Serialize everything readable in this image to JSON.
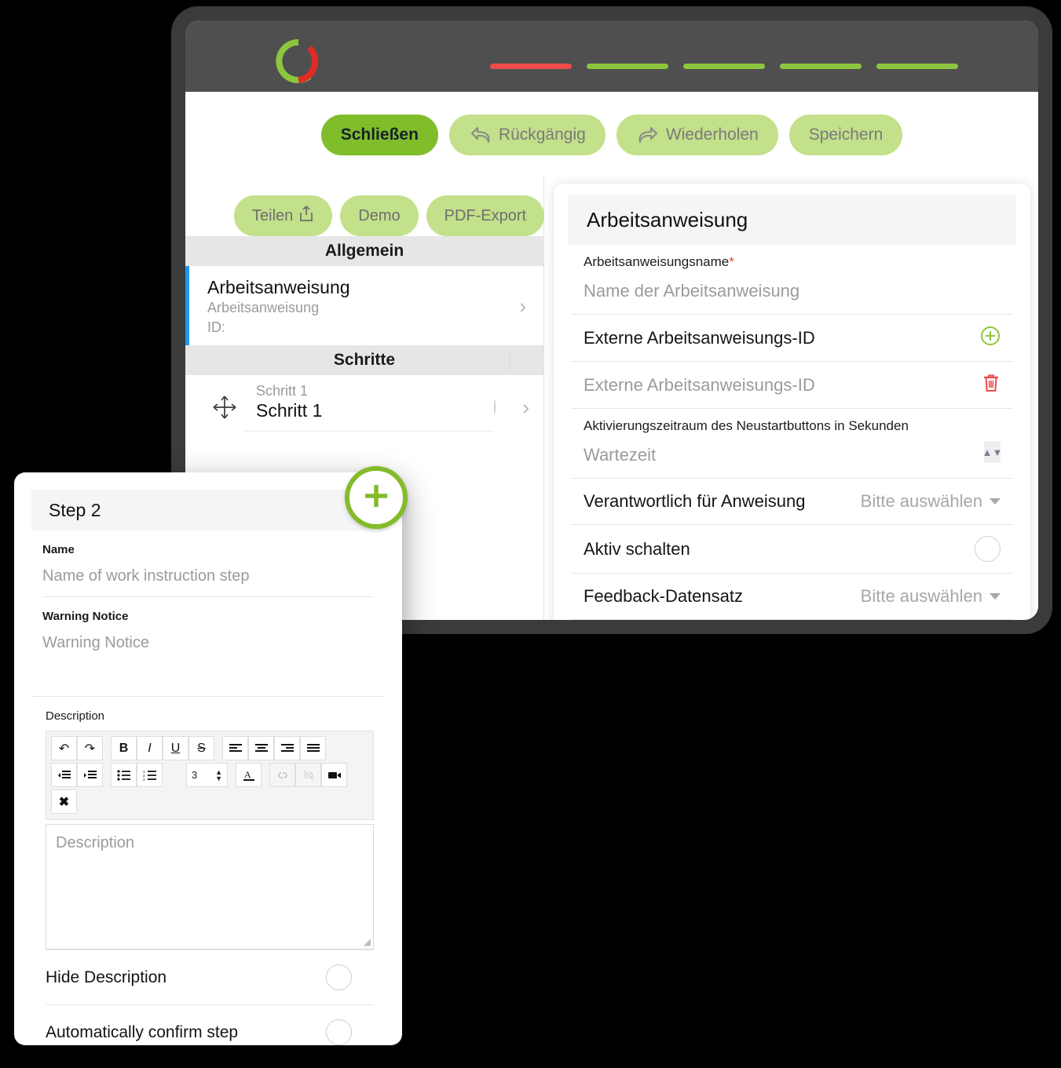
{
  "colors": {
    "brand_green": "#84bb2b",
    "pill_green": "#c3e08a",
    "accent_red": "#ef4b4b",
    "nav_dark": "#4f4f4f",
    "frame_dark": "#3b3b3b",
    "selection_blue": "#2196f3"
  },
  "appbar": {
    "logo_name": "donut-logo",
    "nav_pills": [
      {
        "name": "nav-pill-1",
        "color": "#ef4b4b"
      },
      {
        "name": "nav-pill-2",
        "color": "#8cc63e"
      },
      {
        "name": "nav-pill-3",
        "color": "#8cc63e"
      },
      {
        "name": "nav-pill-4",
        "color": "#8cc63e"
      },
      {
        "name": "nav-pill-5",
        "color": "#8cc63e"
      }
    ]
  },
  "toolbar": {
    "close_label": "Schließen",
    "undo_label": "Rückgängig",
    "redo_label": "Wiederholen",
    "save_label": "Speichern"
  },
  "left_pane": {
    "actions": {
      "share_label": "Teilen",
      "demo_label": "Demo",
      "pdf_label": "PDF-Export"
    },
    "sections": {
      "general_header": "Allgemein",
      "steps_header": "Schritte"
    },
    "instruction_item": {
      "title": "Arbeitsanweisung",
      "subtitle": "Arbeitsanweisung",
      "id_line": "ID:"
    },
    "steps": [
      {
        "sub": "Schritt 1",
        "title": "Schritt 1"
      }
    ]
  },
  "form": {
    "card_title": "Arbeitsanweisung",
    "name_label": "Arbeitsanweisungsname",
    "name_required_mark": "*",
    "name_placeholder": "Name der Arbeitsanweisung",
    "external_id_label": "Externe Arbeitsanweisungs-ID",
    "external_id_placeholder": "Externe Arbeitsanweisungs-ID",
    "wait_label": "Aktivierungszeitraum des Neustartbuttons in Sekunden",
    "wait_placeholder": "Wartezeit",
    "responsible_label": "Verantwortlich für Anweisung",
    "responsible_value": "Bitte auswählen",
    "active_label": "Aktiv schalten",
    "feedback_label": "Feedback-Datensatz",
    "feedback_value": "Bitte auswählen"
  },
  "step_dialog": {
    "title": "Step 2",
    "name_label": "Name",
    "name_placeholder": "Name of work instruction step",
    "warning_label": "Warning Notice",
    "warning_placeholder": "Warning Notice",
    "description_label": "Description",
    "description_placeholder": "Description",
    "hide_description_label": "Hide Description",
    "auto_confirm_label": "Automatically confirm step",
    "editor_toolbar": {
      "font_size_value": "3",
      "buttons": [
        {
          "name": "undo-icon",
          "glyph": "↺"
        },
        {
          "name": "redo-icon",
          "glyph": "↻"
        },
        {
          "name": "bold-icon",
          "glyph": "B"
        },
        {
          "name": "italic-icon",
          "glyph": "I"
        },
        {
          "name": "underline-icon",
          "glyph": "U"
        },
        {
          "name": "strikethrough-icon",
          "glyph": "S"
        },
        {
          "name": "align-left-icon",
          "glyph": "≡"
        },
        {
          "name": "align-center-icon",
          "glyph": "≡"
        },
        {
          "name": "align-right-icon",
          "glyph": "≡"
        },
        {
          "name": "align-justify-icon",
          "glyph": "≡"
        },
        {
          "name": "outdent-icon",
          "glyph": "⇤"
        },
        {
          "name": "indent-icon",
          "glyph": "⇥"
        },
        {
          "name": "bullet-list-icon",
          "glyph": "≔"
        },
        {
          "name": "numbered-list-icon",
          "glyph": "≕"
        },
        {
          "name": "font-color-icon",
          "glyph": "A"
        },
        {
          "name": "insert-link-icon",
          "glyph": "🔗"
        },
        {
          "name": "remove-link-icon",
          "glyph": "🔗"
        },
        {
          "name": "insert-video-icon",
          "glyph": "▮"
        },
        {
          "name": "clear-format-icon",
          "glyph": "✖"
        }
      ]
    }
  },
  "fab": {
    "add_step_label": "add-step"
  }
}
